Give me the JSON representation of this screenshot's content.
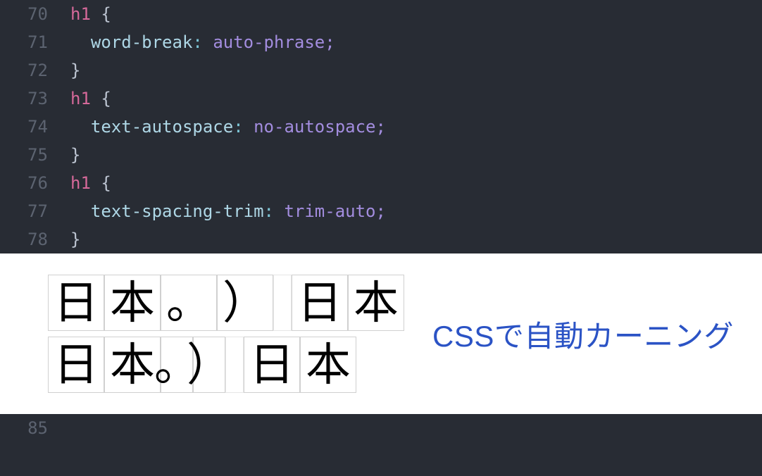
{
  "editor": {
    "lines": [
      {
        "num": "70",
        "indent": "",
        "tokens": [
          {
            "cls": "tok-selector",
            "t": "h1"
          },
          {
            "cls": "tok-plain",
            "t": " {"
          }
        ]
      },
      {
        "num": "71",
        "indent": "  ",
        "tokens": [
          {
            "cls": "tok-prop",
            "t": "word-break"
          },
          {
            "cls": "tok-colon",
            "t": ":"
          },
          {
            "cls": "tok-plain",
            "t": " "
          },
          {
            "cls": "tok-value",
            "t": "auto-phrase"
          },
          {
            "cls": "tok-semi",
            "t": ";"
          }
        ]
      },
      {
        "num": "72",
        "indent": "",
        "tokens": [
          {
            "cls": "tok-plain",
            "t": "}"
          }
        ]
      },
      {
        "num": "73",
        "indent": "",
        "tokens": [
          {
            "cls": "tok-selector",
            "t": "h1"
          },
          {
            "cls": "tok-plain",
            "t": " {"
          }
        ]
      },
      {
        "num": "74",
        "indent": "  ",
        "tokens": [
          {
            "cls": "tok-prop",
            "t": "text-autospace"
          },
          {
            "cls": "tok-colon",
            "t": ":"
          },
          {
            "cls": "tok-plain",
            "t": " "
          },
          {
            "cls": "tok-value",
            "t": "no-autospace"
          },
          {
            "cls": "tok-semi",
            "t": ";"
          }
        ]
      },
      {
        "num": "75",
        "indent": "",
        "tokens": [
          {
            "cls": "tok-plain",
            "t": "}"
          }
        ]
      },
      {
        "num": "76",
        "indent": "",
        "tokens": [
          {
            "cls": "tok-selector",
            "t": "h1"
          },
          {
            "cls": "tok-plain",
            "t": " {"
          }
        ]
      },
      {
        "num": "77",
        "indent": "  ",
        "tokens": [
          {
            "cls": "tok-prop",
            "t": "text-spacing-trim"
          },
          {
            "cls": "tok-colon",
            "t": ":"
          },
          {
            "cls": "tok-plain",
            "t": " "
          },
          {
            "cls": "tok-value",
            "t": "trim-auto"
          },
          {
            "cls": "tok-semi",
            "t": ";"
          }
        ]
      },
      {
        "num": "78",
        "indent": "",
        "tokens": [
          {
            "cls": "tok-plain",
            "t": "}"
          }
        ]
      }
    ],
    "bottom_line_num": "85"
  },
  "demo": {
    "row1": [
      {
        "c": "日",
        "w": "g-full"
      },
      {
        "c": "本",
        "w": "g-full"
      },
      {
        "c": "。",
        "w": "g-wide"
      },
      {
        "c": "）",
        "w": "g-wide"
      },
      {
        "c": "",
        "w": "g-space"
      },
      {
        "c": "日",
        "w": "g-full"
      },
      {
        "c": "本",
        "w": "g-full"
      }
    ],
    "row2": [
      {
        "c": "日",
        "w": "g-full"
      },
      {
        "c": "本",
        "w": "g-full"
      },
      {
        "c": "。",
        "w": "g-half"
      },
      {
        "c": "）",
        "w": "g-half"
      },
      {
        "c": "",
        "w": "g-space"
      },
      {
        "c": "日",
        "w": "g-full"
      },
      {
        "c": "本",
        "w": "g-full"
      }
    ],
    "caption": "CSSで自動カーニング"
  }
}
